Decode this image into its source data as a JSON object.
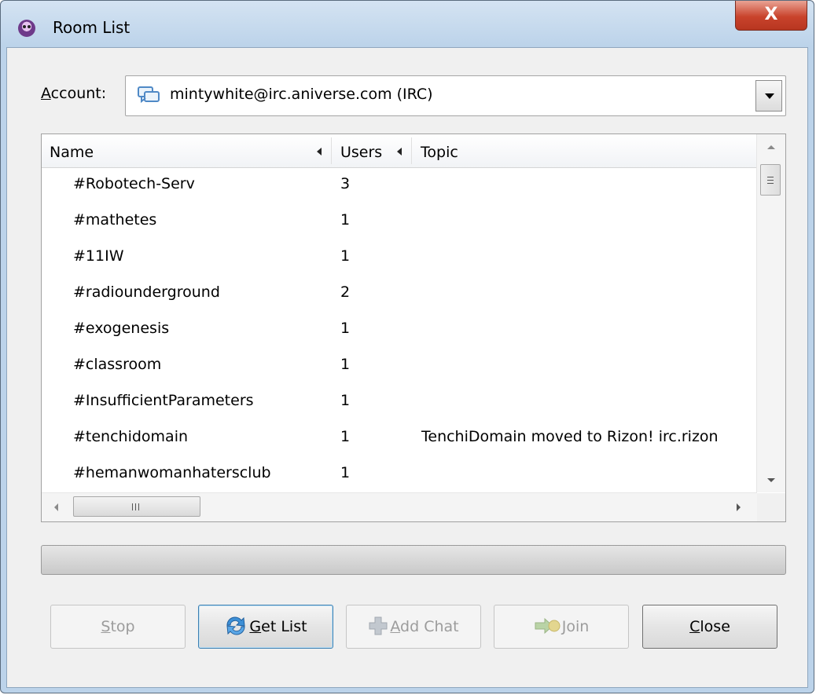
{
  "window": {
    "title": "Room List",
    "close_symbol": "X",
    "app_icon": "pidgin-icon"
  },
  "account": {
    "label_prefix": "A",
    "label_rest": "ccount:",
    "value": "mintywhite@irc.aniverse.com (IRC)",
    "icon": "irc-account-icon"
  },
  "table": {
    "columns": [
      "Name",
      "Users",
      "Topic"
    ],
    "rows": [
      {
        "name": "#Robotech-Serv",
        "users": "3",
        "topic": ""
      },
      {
        "name": "#mathetes",
        "users": "1",
        "topic": ""
      },
      {
        "name": "#11IW",
        "users": "1",
        "topic": ""
      },
      {
        "name": "#radiounderground",
        "users": "2",
        "topic": ""
      },
      {
        "name": "#exogenesis",
        "users": "1",
        "topic": ""
      },
      {
        "name": "#classroom",
        "users": "1",
        "topic": ""
      },
      {
        "name": "#InsufficientParameters",
        "users": "1",
        "topic": ""
      },
      {
        "name": "#tenchidomain",
        "users": "1",
        "topic": "TenchiDomain moved to Rizon! irc.rizon"
      },
      {
        "name": "#hemanwomanhatersclub",
        "users": "1",
        "topic": ""
      }
    ],
    "hscroll_grip": "III"
  },
  "progress": {
    "fraction": 0.0
  },
  "buttons": {
    "stop": {
      "mnemonic": "S",
      "rest": "top",
      "enabled": false
    },
    "get_list": {
      "mnemonic": "G",
      "rest": "et List",
      "enabled": true
    },
    "add_chat": {
      "mnemonic": "A",
      "rest": "dd Chat",
      "enabled": false
    },
    "join": {
      "mnemonic": "J",
      "rest": "oin",
      "enabled": false
    },
    "close": {
      "mnemonic": "C",
      "rest": "lose",
      "enabled": true
    }
  }
}
